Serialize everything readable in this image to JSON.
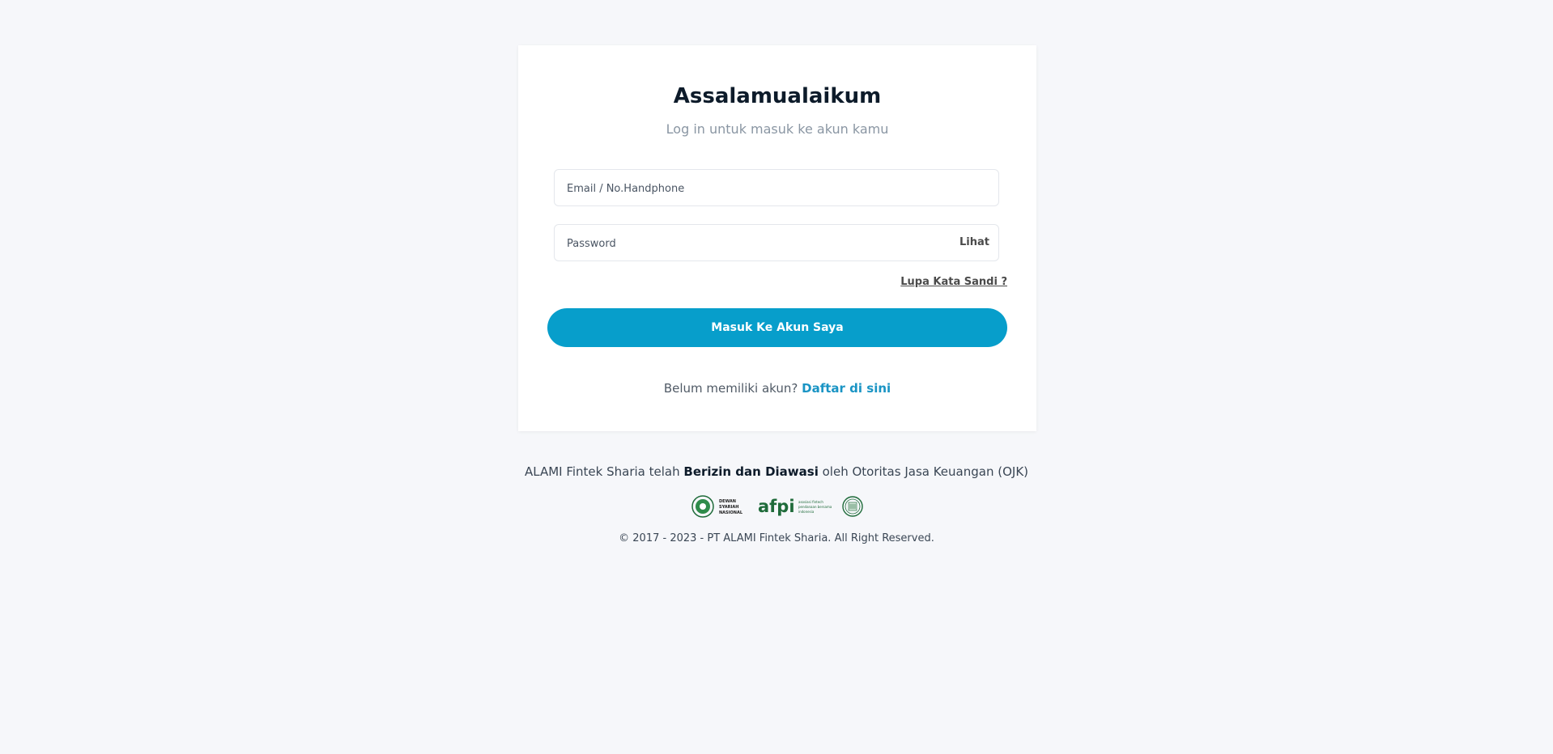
{
  "login": {
    "title": "Assalamualaikum",
    "subtitle": "Log in untuk masuk ke akun kamu",
    "email_placeholder": "Email / No.Handphone",
    "email_value": "",
    "password_placeholder": "Password",
    "password_value": "",
    "show_password_label": "Lihat",
    "forgot_label": "Lupa Kata Sandi ?",
    "submit_label": "Masuk Ke Akun Saya",
    "register_prompt": "Belum memiliki akun?",
    "register_link": "Daftar di sini"
  },
  "footer": {
    "regulated_prefix": "ALAMI Fintek Sharia telah",
    "regulated_bold": "Berizin dan Diawasi",
    "regulated_suffix": "oleh Otoritas Jasa Keuangan (OJK)",
    "logos": {
      "dsn_icon": "dsn-mui-logo",
      "dsn_lines": [
        "DEWAN",
        "SYARIAH",
        "NASIONAL"
      ],
      "afpi_icon": "afpi-logo",
      "afpi_wordmark": "afpi",
      "afpi_tagline": [
        "asosiasi fintech",
        "pendanaan bersama",
        "indonesia"
      ],
      "ojk_icon": "ojk-seal-logo"
    },
    "copyright": "© 2017 - 2023 - PT ALAMI Fintek Sharia. All Right Reserved."
  },
  "colors": {
    "page_bg": "#f6f7fa",
    "primary_button": "#079ecb",
    "link": "#1a94c4",
    "logo_green": "#1f6b3a"
  }
}
